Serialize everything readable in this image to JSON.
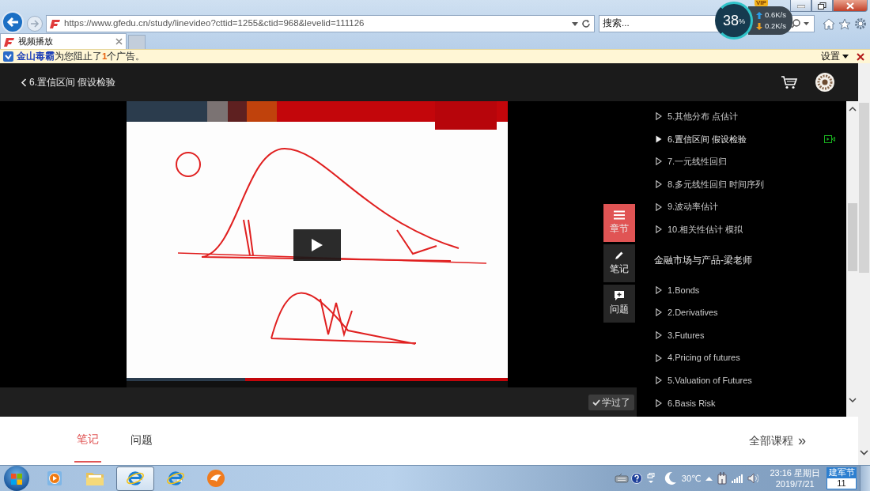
{
  "browser": {
    "url": "https://www.gfedu.cn/study/linevideo?cttid=1255&ctid=968&levelid=111126",
    "search_placeholder": "搜索...",
    "tabs": [
      {
        "title": "视频播放",
        "selected": true
      }
    ]
  },
  "speed_widget": {
    "badge": "VIP",
    "load_value": "38",
    "load_unit": "%",
    "upload": "0.6K/s",
    "download": "0.2K/s"
  },
  "notice": {
    "source": "金山毒霸",
    "message": "为您阻止了**1**个广告。",
    "settings": "设置"
  },
  "header": {
    "title": "6.置信区间 假设检验"
  },
  "side_buttons": [
    {
      "kind": "menu",
      "label": "章节",
      "selected": true
    },
    {
      "kind": "pencil",
      "label": "笔记",
      "selected": false
    },
    {
      "kind": "comment",
      "label": "问题",
      "selected": false
    }
  ],
  "learned_button": "学过了",
  "chapters": {
    "items": [
      {
        "label": "5.其他分布 点估计",
        "current": false
      },
      {
        "label": "6.置信区间 假设检验",
        "current": true
      },
      {
        "label": "7.一元线性回归",
        "current": false
      },
      {
        "label": "8.多元线性回归 时间序列",
        "current": false
      },
      {
        "label": "9.波动率估计",
        "current": false
      },
      {
        "label": "10.相关性估计 模拟",
        "current": false
      }
    ],
    "section": "金融市场与产品-梁老师",
    "section_items": [
      {
        "label": "1.Bonds",
        "current": false
      },
      {
        "label": "2.Derivatives",
        "current": false
      },
      {
        "label": "3.Futures",
        "current": false
      },
      {
        "label": "4.Pricing of futures",
        "current": false
      },
      {
        "label": "5.Valuation of Futures",
        "current": false
      },
      {
        "label": "6.Basis Risk",
        "current": false
      }
    ]
  },
  "bottom_tabs": [
    {
      "label": "笔记",
      "selected": true
    },
    {
      "label": "问题",
      "selected": false
    }
  ],
  "all_courses": {
    "label": "全部课程",
    "arrow": "»"
  },
  "taskbar": {
    "apps": [
      {
        "kind": "player",
        "selected": false
      },
      {
        "kind": "folder",
        "selected": false
      },
      {
        "kind": "ie",
        "selected": true
      },
      {
        "kind": "ie",
        "selected": false
      },
      {
        "kind": "cheetah",
        "selected": false
      }
    ]
  },
  "tray": {
    "temperature": "30℃",
    "time": "23:16",
    "weekday": "星期日",
    "date": "2019/7/21",
    "holiday": "建军节",
    "holiday_day": "11"
  }
}
